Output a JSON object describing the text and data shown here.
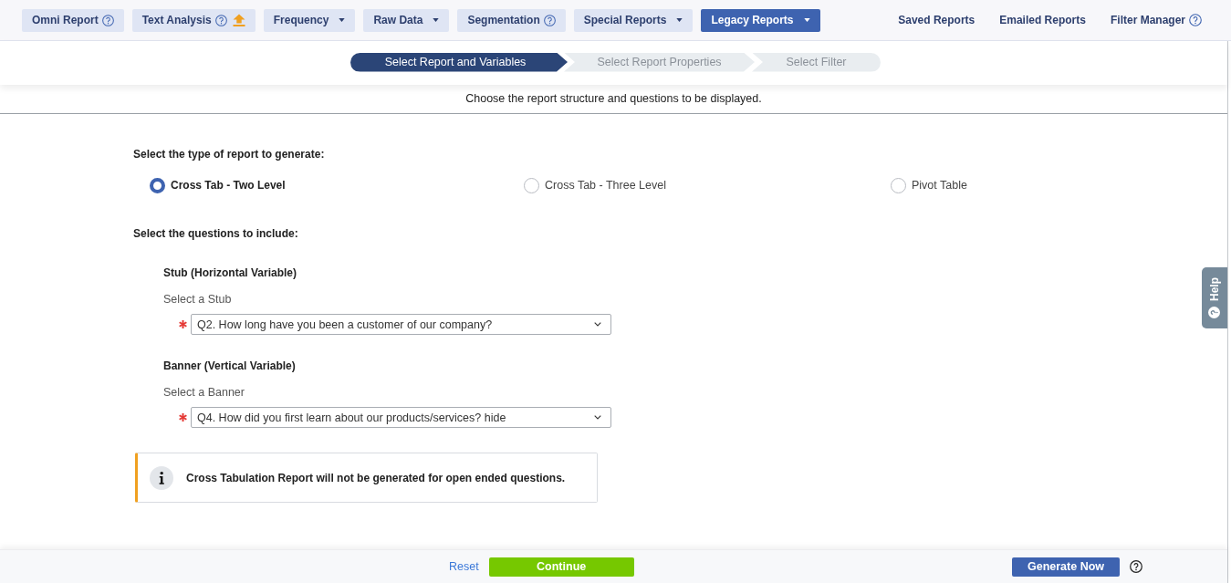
{
  "top_nav": {
    "menus": [
      {
        "label": "Omni Report",
        "kind": "help",
        "selected": false
      },
      {
        "label": "Text Analysis",
        "kind": "help_upgrade",
        "selected": false
      },
      {
        "label": "Frequency",
        "kind": "dropdown",
        "selected": false
      },
      {
        "label": "Raw Data",
        "kind": "dropdown",
        "selected": false
      },
      {
        "label": "Segmentation",
        "kind": "help",
        "selected": false
      },
      {
        "label": "Special Reports",
        "kind": "dropdown",
        "selected": false
      },
      {
        "label": "Legacy Reports",
        "kind": "dropdown",
        "selected": true
      }
    ],
    "links": [
      {
        "label": "Saved Reports",
        "kind": "plain"
      },
      {
        "label": "Emailed Reports",
        "kind": "plain"
      },
      {
        "label": "Filter Manager",
        "kind": "help"
      }
    ]
  },
  "steps": [
    {
      "label": "Select Report and Variables",
      "selected": true
    },
    {
      "label": "Select Report Properties",
      "selected": false
    },
    {
      "label": "Select Filter",
      "selected": false
    }
  ],
  "instructions": "Choose the report structure and questions to be displayed.",
  "report_type": {
    "label": "Select the type of report to generate:",
    "options": [
      {
        "label": "Cross Tab - Two Level",
        "selected": true
      },
      {
        "label": "Cross Tab - Three Level",
        "selected": false
      },
      {
        "label": "Pivot Table",
        "selected": false
      }
    ]
  },
  "questions": {
    "label": "Select the questions to include:",
    "groups": [
      {
        "heading": "Stub (Horizontal Variable)",
        "field_label": "Select a Stub",
        "required": true,
        "value": "Q2. How long have you been a customer of our company?"
      },
      {
        "heading": "Banner (Vertical Variable)",
        "field_label": "Select a Banner",
        "required": true,
        "value": "Q4. How did you first learn about our products/services? hide"
      }
    ]
  },
  "notice": "Cross Tabulation Report will not be generated for open ended questions.",
  "help_tab": "Help",
  "footer": {
    "reset": "Reset",
    "continue": "Continue",
    "generate": "Generate Now"
  }
}
